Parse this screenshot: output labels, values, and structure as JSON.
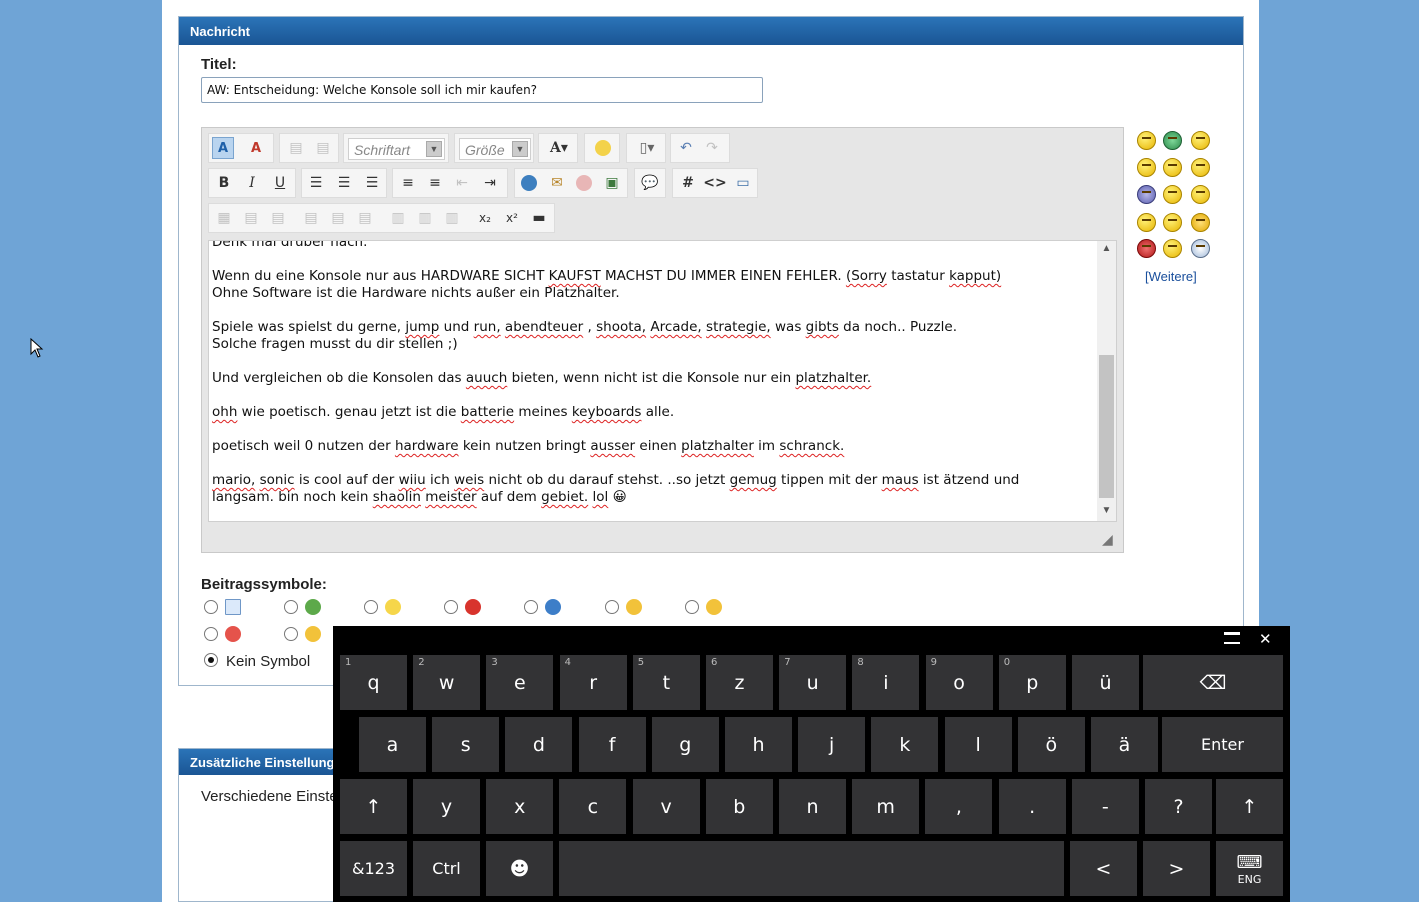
{
  "panel": {
    "title": "Nachricht"
  },
  "title_field": {
    "label": "Titel:",
    "value": "AW: Entscheidung: Welche Konsole soll ich mir kaufen?"
  },
  "toolbar": {
    "font_placeholder": "Schriftart",
    "size_placeholder": "Größe",
    "font_color_label": "A",
    "bold": "B",
    "italic": "I",
    "underline": "U",
    "hash": "#",
    "code": "<>"
  },
  "message": {
    "lines": [
      "Denk mal drüber nach.",
      "",
      "Wenn du eine Konsole nur aus HARDWARE SICHT KAUFST MACHST DU IMMER EINEN FEHLER. (Sorry tastatur kapput)",
      "Ohne Software ist die Hardware nichts außer ein Platzhalter.",
      "",
      "Spiele was spielst du gerne, jump und run, abendteuer , shoota, Arcade, strategie, was gibts da noch.. Puzzle.",
      "Solche fragen musst du dir stellen ;)",
      "",
      "Und vergleichen ob die Konsolen das auuch bieten, wenn nicht ist die Konsole nur ein platzhalter.",
      "",
      "ohh wie poetisch. genau jetzt ist die batterie meines keyboards alle.",
      "",
      "poetisch weil 0 nutzen der hardware kein nutzen bringt ausser einen platzhalter im schranck.",
      "",
      "mario, sonic is cool auf der wiiu ich weis nicht ob du darauf stehst. ..so jetzt gemug tippen mit der maus ist ätzend und",
      "langsam. bin noch kein shaolin meister auf dem gebiet. lol 😀"
    ]
  },
  "smilies": {
    "more_link": "[Weitere]"
  },
  "post_icons": {
    "label": "Beitragssymbole:",
    "none_label": "Kein Symbol"
  },
  "panel2": {
    "title": "Zusätzliche Einstellungen",
    "row": "Verschiedene Einstellungen"
  },
  "keyboard": {
    "row1": [
      {
        "k": "q",
        "n": "1"
      },
      {
        "k": "w",
        "n": "2"
      },
      {
        "k": "e",
        "n": "3"
      },
      {
        "k": "r",
        "n": "4"
      },
      {
        "k": "t",
        "n": "5"
      },
      {
        "k": "z",
        "n": "6"
      },
      {
        "k": "u",
        "n": "7"
      },
      {
        "k": "i",
        "n": "8"
      },
      {
        "k": "o",
        "n": "9"
      },
      {
        "k": "p",
        "n": "0"
      },
      {
        "k": "ü",
        "n": ""
      }
    ],
    "row2": [
      "a",
      "s",
      "d",
      "f",
      "g",
      "h",
      "j",
      "k",
      "l",
      "ö",
      "ä"
    ],
    "row3": [
      "y",
      "x",
      "c",
      "v",
      "b",
      "n",
      "m",
      ",",
      ".",
      "-",
      "?"
    ],
    "enter": "Enter",
    "numsym": "&123",
    "ctrl": "Ctrl",
    "lang": "ENG",
    "left": "<",
    "right": ">"
  }
}
